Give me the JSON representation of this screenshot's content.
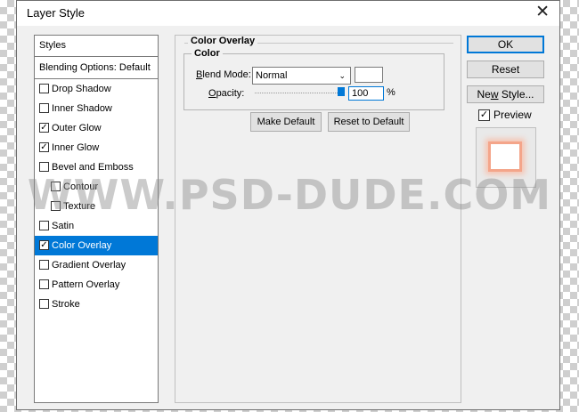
{
  "window": {
    "title": "Layer Style",
    "close": "✕"
  },
  "styles": {
    "header": "Styles",
    "blending": "Blending Options: Default",
    "items": [
      {
        "label": "Drop Shadow",
        "checked": false,
        "indent": false,
        "selected": false
      },
      {
        "label": "Inner Shadow",
        "checked": false,
        "indent": false,
        "selected": false
      },
      {
        "label": "Outer Glow",
        "checked": true,
        "indent": false,
        "selected": false
      },
      {
        "label": "Inner Glow",
        "checked": true,
        "indent": false,
        "selected": false
      },
      {
        "label": "Bevel and Emboss",
        "checked": false,
        "indent": false,
        "selected": false
      },
      {
        "label": "Contour",
        "checked": false,
        "indent": true,
        "selected": false
      },
      {
        "label": "Texture",
        "checked": false,
        "indent": true,
        "selected": false
      },
      {
        "label": "Satin",
        "checked": false,
        "indent": false,
        "selected": false
      },
      {
        "label": "Color Overlay",
        "checked": true,
        "indent": false,
        "selected": true
      },
      {
        "label": "Gradient Overlay",
        "checked": false,
        "indent": false,
        "selected": false
      },
      {
        "label": "Pattern Overlay",
        "checked": false,
        "indent": false,
        "selected": false
      },
      {
        "label": "Stroke",
        "checked": false,
        "indent": false,
        "selected": false
      }
    ]
  },
  "overlay": {
    "group_title": "Color Overlay",
    "sub_title": "Color",
    "blend_mode_label": "Blend Mode:",
    "blend_mode_value": "Normal",
    "blend_chevron": "⌄",
    "overlay_color": "#ffffff",
    "opacity_label": "Opacity:",
    "opacity_value": "100",
    "opacity_unit": "%",
    "opacity_level": 1.0,
    "make_default": "Make Default",
    "reset_to_default": "Reset to Default"
  },
  "buttons": {
    "ok": "OK",
    "reset": "Reset",
    "new_style": "New Style...",
    "preview": "Preview",
    "preview_checked": true
  },
  "watermark": "WWW.PSD-DUDE.COM",
  "colors": {
    "accent": "#0078d7",
    "glow": "#f4a58a"
  }
}
